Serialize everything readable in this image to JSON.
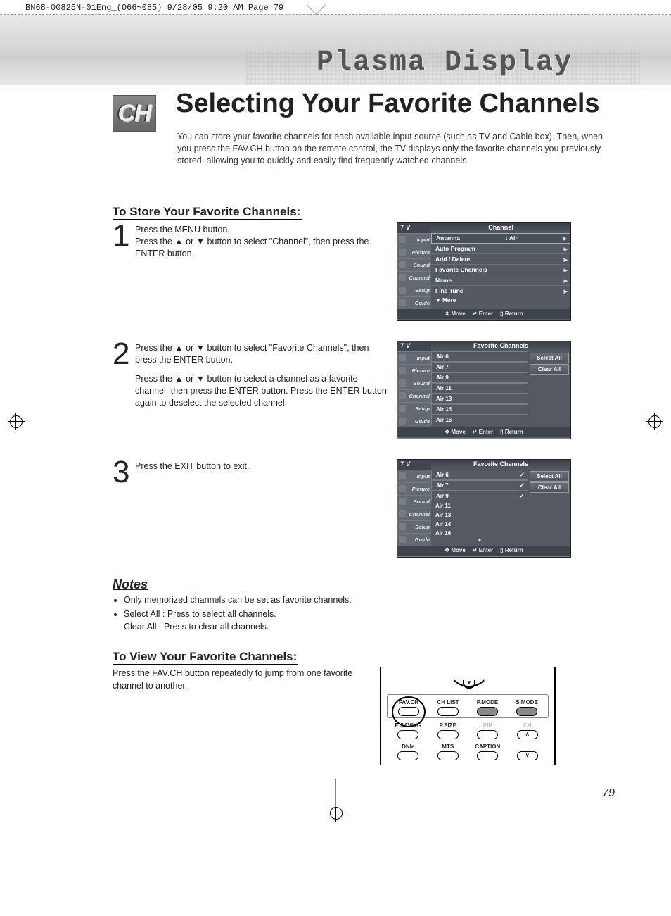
{
  "crop_header": "BN68-00825N-01Eng_(066~085)  9/28/05  9:20 AM  Page 79",
  "banner_title": "Plasma Display",
  "badge": "CH",
  "page_title": "Selecting Your Favorite Channels",
  "intro": "You can store your favorite channels for each available input source (such as TV and Cable box). Then, when you press the FAV.CH button on the remote control, the TV displays only the favorite channels you previously stored, allowing you to quickly and easily find frequently watched channels.",
  "section_store_title": "To Store Your Favorite Channels:",
  "steps": {
    "s1_num": "1",
    "s1_l1": "Press the MENU button.",
    "s1_l2": "Press the ▲ or ▼ button to select \"Channel\", then press the ENTER button.",
    "s2_num": "2",
    "s2_l1": "Press the ▲ or ▼ button to select \"Favorite Channels\", then press the ENTER button.",
    "s2_l2": "Press the ▲ or ▼ button to select a channel as a favorite channel, then press the ENTER button. Press the ENTER button again to deselect the selected channel.",
    "s3_num": "3",
    "s3_l1": "Press the EXIT button to exit."
  },
  "osd_common": {
    "tv": "T V",
    "sidebar": [
      "Input",
      "Picture",
      "Sound",
      "Channel",
      "Setup",
      "Guide"
    ],
    "footer_move": "Move",
    "footer_enter": "Enter",
    "footer_return": "Return",
    "footer_move_icon": "⬍",
    "footer_move_icon2": "✥",
    "footer_enter_icon": "↵",
    "footer_return_icon": "▯"
  },
  "osd1": {
    "title": "Channel",
    "rows": [
      {
        "label": "Antenna",
        "value": ": Air"
      },
      {
        "label": "Auto Program",
        "value": ""
      },
      {
        "label": "Add / Delete",
        "value": ""
      },
      {
        "label": "Favorite Channels",
        "value": ""
      },
      {
        "label": "Name",
        "value": ""
      },
      {
        "label": "Fine Tune",
        "value": ""
      }
    ],
    "more": "▼ More"
  },
  "osd2": {
    "title": "Favorite Channels",
    "channels": [
      "Air 6",
      "Air 7",
      "Air 9",
      "Air 11",
      "Air 13",
      "Air 14",
      "Air 16"
    ],
    "btn_select_all": "Select All",
    "btn_clear_all": "Clear All"
  },
  "osd3": {
    "title": "Favorite Channels",
    "channels": [
      {
        "label": "Air 6",
        "checked": true
      },
      {
        "label": "Air 7",
        "checked": true
      },
      {
        "label": "Air 9",
        "checked": true
      },
      {
        "label": "Air 11",
        "checked": false
      },
      {
        "label": "Air 13",
        "checked": false
      },
      {
        "label": "Air 14",
        "checked": false
      },
      {
        "label": "Air 16",
        "checked": false
      }
    ],
    "btn_select_all": "Select All",
    "btn_clear_all": "Clear All"
  },
  "notes_title": "Notes",
  "notes": {
    "n1": "Only memorized channels can be set as favorite channels.",
    "n2a": "Select All : Press to select all channels.",
    "n2b": "Clear All : Press to clear all channels."
  },
  "section_view_title": "To View Your Favorite Channels:",
  "view_text": "Press the FAV.CH button repeatedly to jump from one favorite channel to another.",
  "remote": {
    "row1": [
      "FAV.CH",
      "CH LIST",
      "P.MODE",
      "S.MODE"
    ],
    "row2": [
      "E.SAVING",
      "P.SIZE",
      "PIP",
      "∧"
    ],
    "row3": [
      "DNIe",
      "MTS",
      "CAPTION",
      "∨"
    ],
    "row2_last_label": "CH"
  },
  "page_number": "79"
}
